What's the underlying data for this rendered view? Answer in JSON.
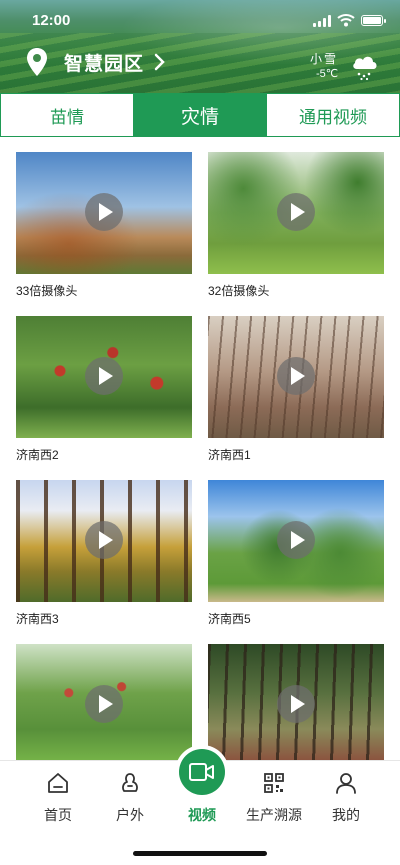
{
  "status": {
    "time": "12:00"
  },
  "header": {
    "location": "智慧园区",
    "weather_desc": "小雪",
    "weather_temp": "-5℃"
  },
  "tabs": [
    {
      "label": "苗情",
      "active": false
    },
    {
      "label": "灾情",
      "active": true
    },
    {
      "label": "通用视频",
      "active": false
    }
  ],
  "videos": [
    {
      "label": "33倍摄像头"
    },
    {
      "label": "32倍摄像头"
    },
    {
      "label": "济南西2"
    },
    {
      "label": "济南西1"
    },
    {
      "label": "济南西3"
    },
    {
      "label": "济南西5"
    },
    {
      "label": ""
    },
    {
      "label": ""
    }
  ],
  "nav": [
    {
      "label": "首页",
      "icon": "home-icon"
    },
    {
      "label": "户外",
      "icon": "outdoor-icon"
    },
    {
      "label": "视频",
      "icon": "video-camera-icon",
      "active": true
    },
    {
      "label": "生产溯源",
      "icon": "qr-code-icon"
    },
    {
      "label": "我的",
      "icon": "user-icon"
    }
  ],
  "colors": {
    "primary": "#1f9a55"
  }
}
